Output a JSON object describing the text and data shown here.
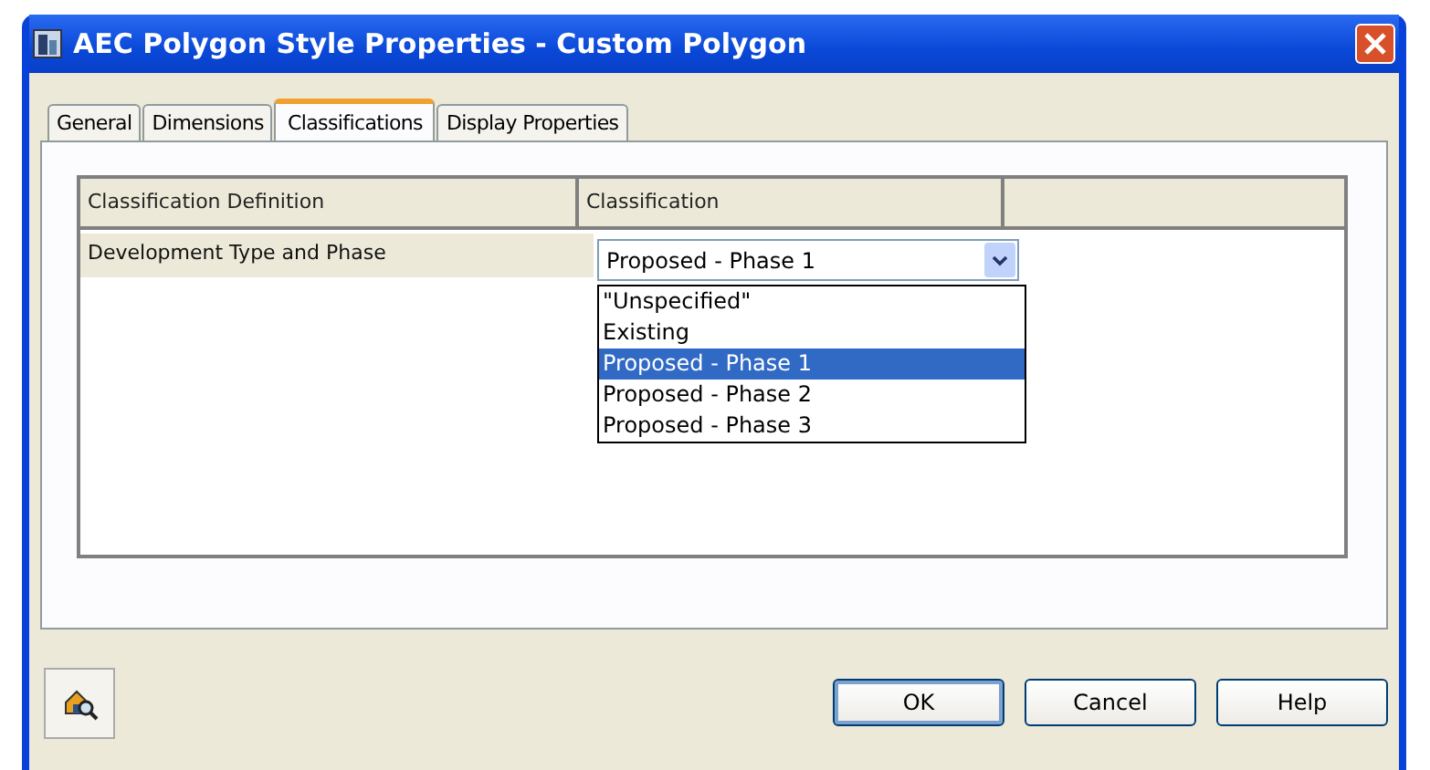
{
  "window": {
    "title": "AEC Polygon Style Properties - Custom Polygon"
  },
  "tabs": [
    {
      "label": "General",
      "selected": false
    },
    {
      "label": "Dimensions",
      "selected": false
    },
    {
      "label": "Classifications",
      "selected": true
    },
    {
      "label": "Display Properties",
      "selected": false
    }
  ],
  "table": {
    "columns": [
      "Classification Definition",
      "Classification"
    ],
    "rows": [
      {
        "definition": "Development Type and Phase",
        "classification": "Proposed - Phase 1"
      }
    ]
  },
  "dropdown": {
    "options": [
      {
        "label": "\"Unspecified\"",
        "selected": false
      },
      {
        "label": "Existing",
        "selected": false
      },
      {
        "label": "Proposed - Phase 1",
        "selected": true
      },
      {
        "label": "Proposed - Phase 2",
        "selected": false
      },
      {
        "label": "Proposed - Phase 3",
        "selected": false
      }
    ]
  },
  "buttons": [
    {
      "label": "OK",
      "kind": "default"
    },
    {
      "label": "Cancel",
      "kind": "normal"
    },
    {
      "label": "Help",
      "kind": "normal"
    }
  ]
}
